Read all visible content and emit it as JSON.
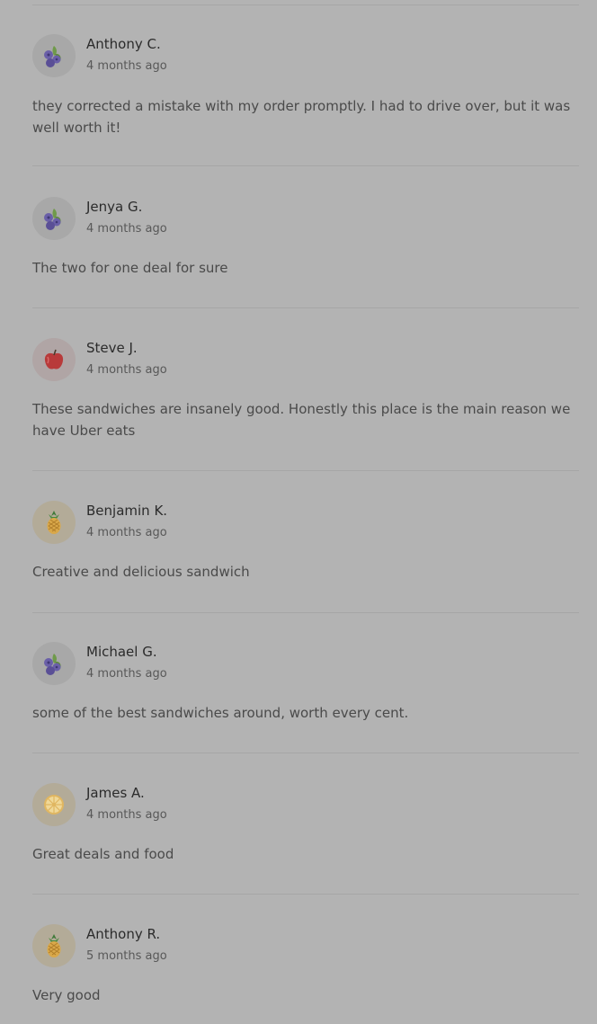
{
  "reviews": [
    {
      "name": "Anthony C.",
      "date": "4 months ago",
      "avatar": "blueberry-icon",
      "text": "they corrected a mistake with my order promptly. I had to drive over, but it was well worth it!"
    },
    {
      "name": "Jenya G.",
      "date": "4 months ago",
      "avatar": "blueberry-icon",
      "text": "The two for one deal for sure"
    },
    {
      "name": "Steve J.",
      "date": "4 months ago",
      "avatar": "apple-icon",
      "text": "These sandwiches are insanely good. Honestly this place is the main reason we have Uber eats"
    },
    {
      "name": "Benjamin K.",
      "date": "4 months ago",
      "avatar": "pineapple-icon",
      "text": "Creative and delicious sandwich"
    },
    {
      "name": "Michael G.",
      "date": "4 months ago",
      "avatar": "blueberry-icon",
      "text": "some of the best sandwiches around, worth every cent."
    },
    {
      "name": "James A.",
      "date": "4 months ago",
      "avatar": "citrus-slice-icon",
      "text": "Great deals and food"
    },
    {
      "name": "Anthony R.",
      "date": "5 months ago",
      "avatar": "pineapple-icon",
      "text": "Very good"
    }
  ]
}
